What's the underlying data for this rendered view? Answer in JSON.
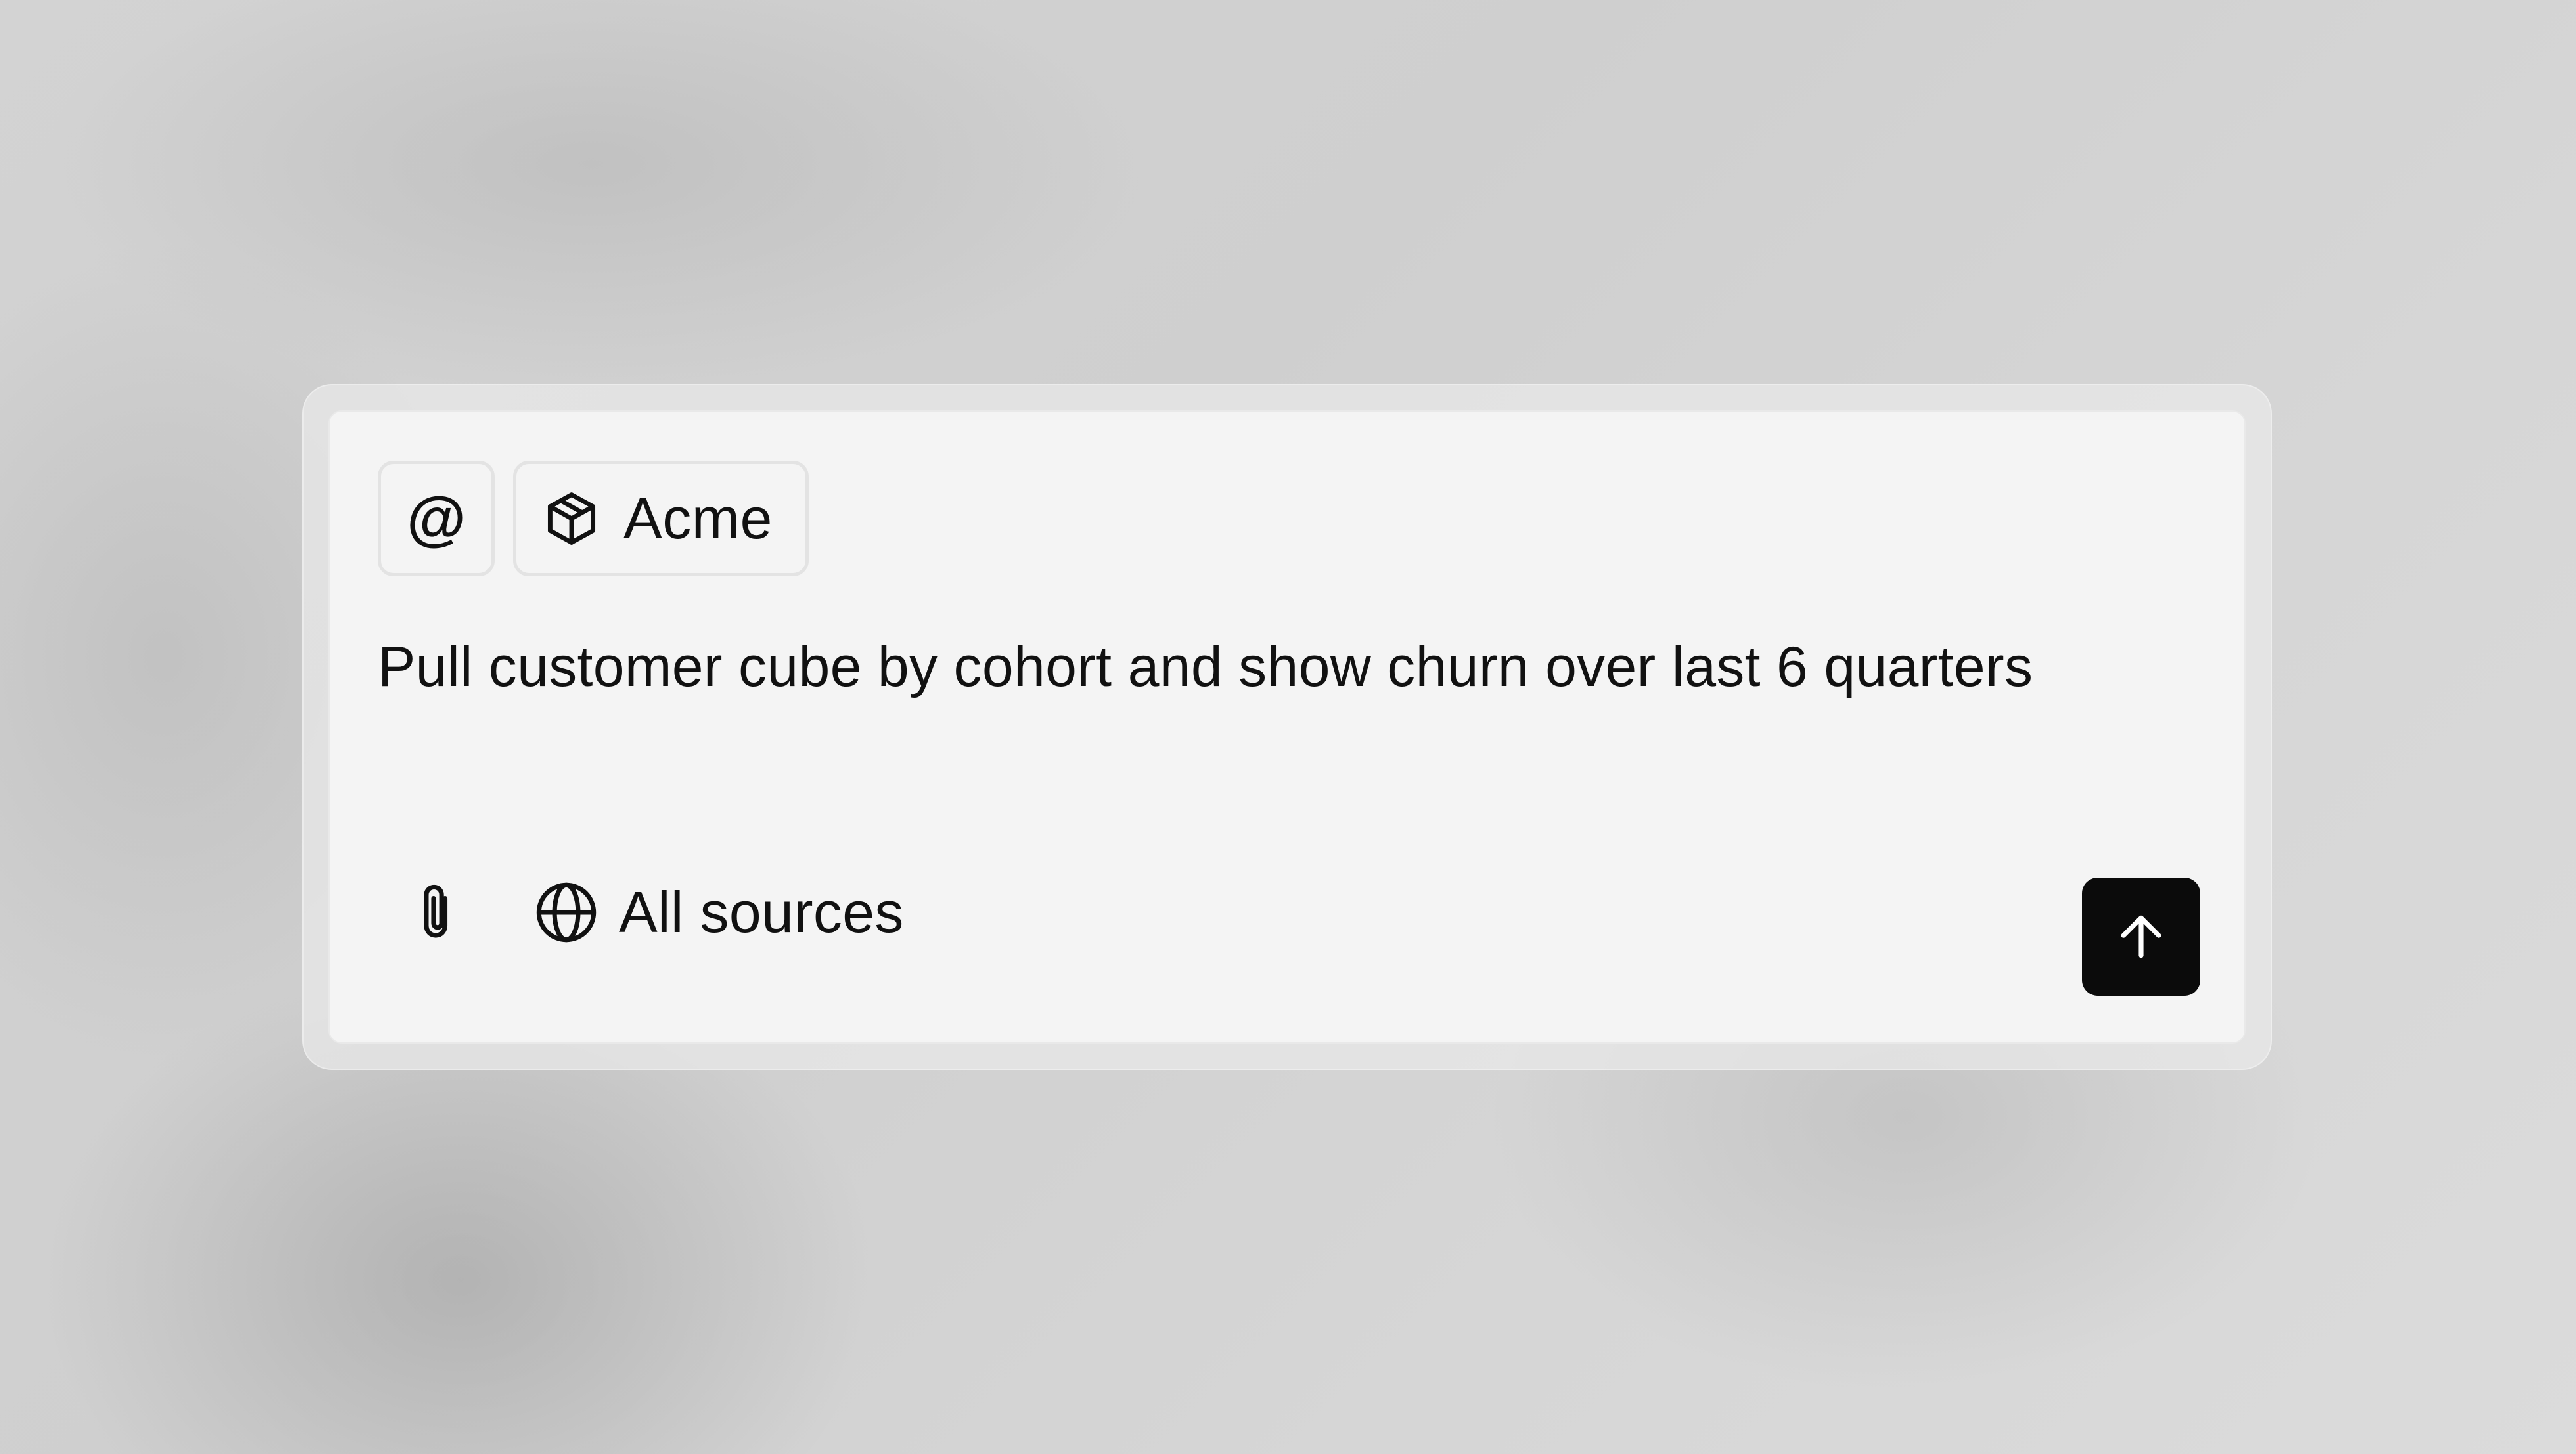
{
  "composer": {
    "mention_chip": {
      "symbol": "@",
      "icon": "at-sign-icon"
    },
    "context_chip": {
      "label": "Acme",
      "icon": "cube-icon"
    },
    "prompt_text": "Pull customer cube by cohort and show churn over last 6 quarters",
    "attach_button": {
      "icon": "paperclip-icon"
    },
    "sources_button": {
      "label": "All sources",
      "icon": "globe-icon"
    },
    "send_button": {
      "icon": "arrow-up-icon",
      "background": "#0b0b0b"
    }
  },
  "colors": {
    "panel_background": "#f4f4f4",
    "chip_border": "#e3e3e3",
    "text": "#111111",
    "page_background": "#d3d3d3"
  }
}
